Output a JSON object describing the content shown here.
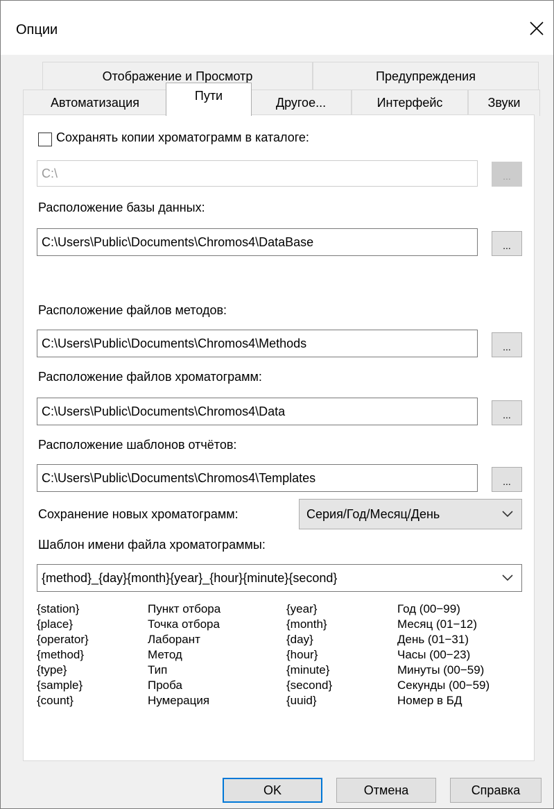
{
  "window": {
    "title": "Опции"
  },
  "tabs": {
    "row1": [
      "Отображение и Просмотр",
      "Предупреждения"
    ],
    "row2": [
      "Автоматизация",
      "Пути",
      "Другое...",
      "Интерфейс",
      "Звуки"
    ]
  },
  "paths": {
    "copy_checkbox_label": "Сохранять копии хроматограмм в каталоге:",
    "copy_checkbox_checked": false,
    "copy_dir_value": "C:\\",
    "db_label": "Расположение базы данных:",
    "db_value": "C:\\Users\\Public\\Documents\\Chromos4\\DataBase",
    "methods_label": "Расположение файлов методов:",
    "methods_value": "C:\\Users\\Public\\Documents\\Chromos4\\Methods",
    "chrom_label": "Расположение файлов хроматограмм:",
    "chrom_value": "C:\\Users\\Public\\Documents\\Chromos4\\Data",
    "templates_label": "Расположение шаблонов отчётов:",
    "templates_value": "C:\\Users\\Public\\Documents\\Chromos4\\Templates",
    "browse_label": "...",
    "save_new_label": "Сохранение новых хроматограмм:",
    "save_new_value": "Серия/Год/Месяц/День",
    "filename_template_label": "Шаблон имени файла хроматограммы:",
    "filename_template_value": "{method}_{day}{month}{year}_{hour}{minute}{second}"
  },
  "legend": {
    "col1_keys": [
      "{station}",
      "{place}",
      "{operator}",
      "{method}",
      "{type}",
      "{sample}",
      "{count}"
    ],
    "col1_desc": [
      "Пункт отбора",
      "Точка отбора",
      "Лаборант",
      "Метод",
      "Тип",
      "Проба",
      "Нумерация"
    ],
    "col2_keys": [
      "{year}",
      "{month}",
      "{day}",
      "{hour}",
      "{minute}",
      "{second}",
      "{uuid}"
    ],
    "col2_desc": [
      "Год (00−99)",
      "Месяц (01−12)",
      "День (01−31)",
      "Часы (00−23)",
      "Минуты (00−59)",
      "Секунды (00−59)",
      "Номер в БД"
    ]
  },
  "buttons": {
    "ok": "OK",
    "cancel": "Отмена",
    "help": "Справка"
  },
  "colors": {
    "accent": "#0078d7",
    "window_bg": "#f0f0f0",
    "panel_bg": "#ffffff"
  },
  "icons": {
    "close": "close-icon",
    "dropdown": "chevron-down-icon"
  }
}
